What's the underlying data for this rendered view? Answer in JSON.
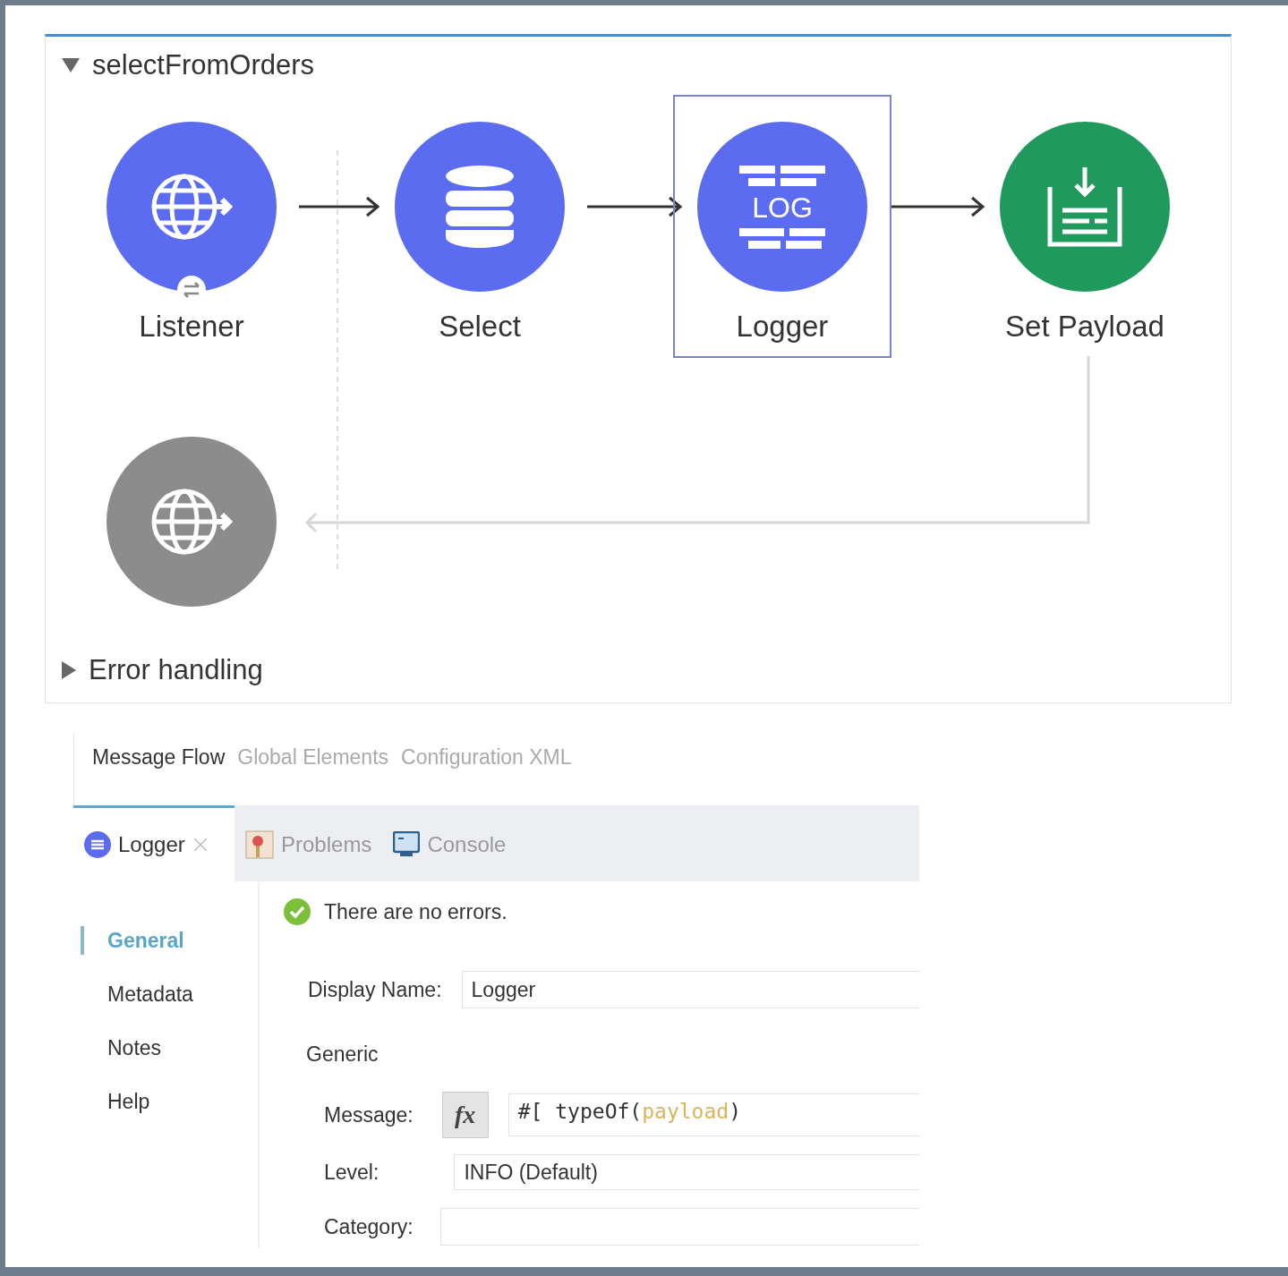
{
  "flow": {
    "name": "selectFromOrders",
    "expanded": true,
    "nodes": [
      {
        "kind": "listener",
        "label": "Listener",
        "color": "#5b6cf0",
        "selected": false
      },
      {
        "kind": "database",
        "label": "Select",
        "color": "#5b6cf0",
        "selected": false
      },
      {
        "kind": "logger",
        "label": "Logger",
        "icon_text": "LOG",
        "color": "#5b6cf0",
        "selected": true
      },
      {
        "kind": "set-payload",
        "label": "Set Payload",
        "color": "#1f9a5c",
        "selected": false
      }
    ],
    "error_source": {
      "kind": "listener",
      "color": "#8c8c8c"
    },
    "error_handling": {
      "label": "Error handling",
      "expanded": false
    }
  },
  "editor_tabs": [
    {
      "label": "Message Flow",
      "selected": true
    },
    {
      "label": "Global Elements",
      "selected": false
    },
    {
      "label": "Configuration XML",
      "selected": false
    }
  ],
  "view_tabs": [
    {
      "kind": "logger",
      "label": "Logger",
      "selected": true,
      "closable": true
    },
    {
      "kind": "problems",
      "label": "Problems",
      "selected": false,
      "closable": false
    },
    {
      "kind": "console",
      "label": "Console",
      "selected": false,
      "closable": false
    }
  ],
  "status": "There are no errors.",
  "nav": [
    {
      "label": "General",
      "selected": true
    },
    {
      "label": "Metadata",
      "selected": false
    },
    {
      "label": "Notes",
      "selected": false
    },
    {
      "label": "Help",
      "selected": false
    }
  ],
  "form": {
    "display_name": {
      "label": "Display Name:",
      "value": "Logger"
    },
    "section": "Generic",
    "message": {
      "label": "Message:",
      "button": "fx",
      "prefix": "#[ typeOf(",
      "highlight": "payload",
      "suffix": ")"
    },
    "level": {
      "label": "Level:",
      "value": "INFO (Default)"
    },
    "category": {
      "label": "Category:"
    }
  }
}
